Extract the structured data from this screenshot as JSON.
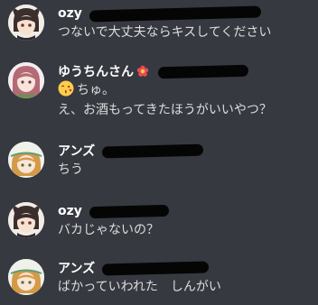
{
  "messages": [
    {
      "username": "ozy",
      "lines": [
        "つないで大丈夫ならキスしてください"
      ]
    },
    {
      "username": "ゆうちんさん",
      "lines": [
        "ちゅ。",
        "え、お酒もってきたほうがいいやつ？"
      ],
      "emoji": "kissing-face-icon"
    },
    {
      "username": "アンズ",
      "lines": [
        "ちう"
      ]
    },
    {
      "username": "ozy",
      "lines": [
        "バカじゃないの？"
      ]
    },
    {
      "username": "アンズ",
      "lines": [
        "ばかっていわれた　しんがい"
      ]
    }
  ],
  "colors": {
    "background": "#36393f",
    "username": "#ffffff",
    "text": "#dcddde",
    "redaction": "#050506"
  }
}
